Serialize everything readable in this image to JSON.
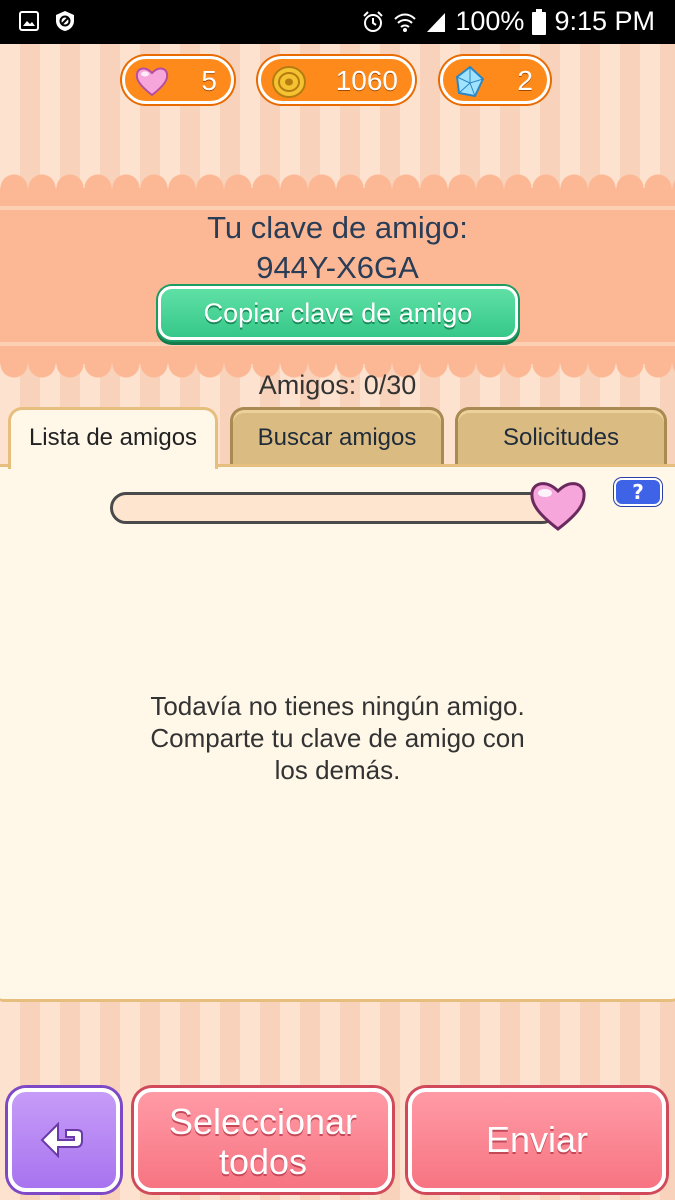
{
  "status_bar": {
    "battery": "100%",
    "time": "9:15 PM",
    "icons": [
      "gallery-icon",
      "shield-icon",
      "alarm-icon",
      "wifi-icon",
      "signal-icon",
      "battery-icon"
    ]
  },
  "currencies": {
    "hearts": "5",
    "coins": "1060",
    "gems": "2"
  },
  "friend_key": {
    "title": "Tu clave de amigo:",
    "value": "944Y-X6GA",
    "copy_label": "Copiar clave de amigo"
  },
  "friends_count": "Amigos: 0/30",
  "tabs": [
    {
      "label": "Lista de amigos",
      "active": true
    },
    {
      "label": "Buscar amigos",
      "active": false
    },
    {
      "label": "Solicitudes",
      "active": false
    }
  ],
  "help_label": "?",
  "empty_message": {
    "line1": "Todavía no tienes ningún amigo.",
    "line2": "Comparte tu clave de amigo con",
    "line3": "los demás."
  },
  "bottom": {
    "select_all_line1": "Seleccionar",
    "select_all_line2": "todos",
    "send_label": "Enviar"
  },
  "colors": {
    "accent_orange": "#fe8a1c",
    "copy_green": "#36c889",
    "pink_button": "#f77482",
    "back_purple": "#a874ef",
    "tab_tan": "#dabb82"
  }
}
